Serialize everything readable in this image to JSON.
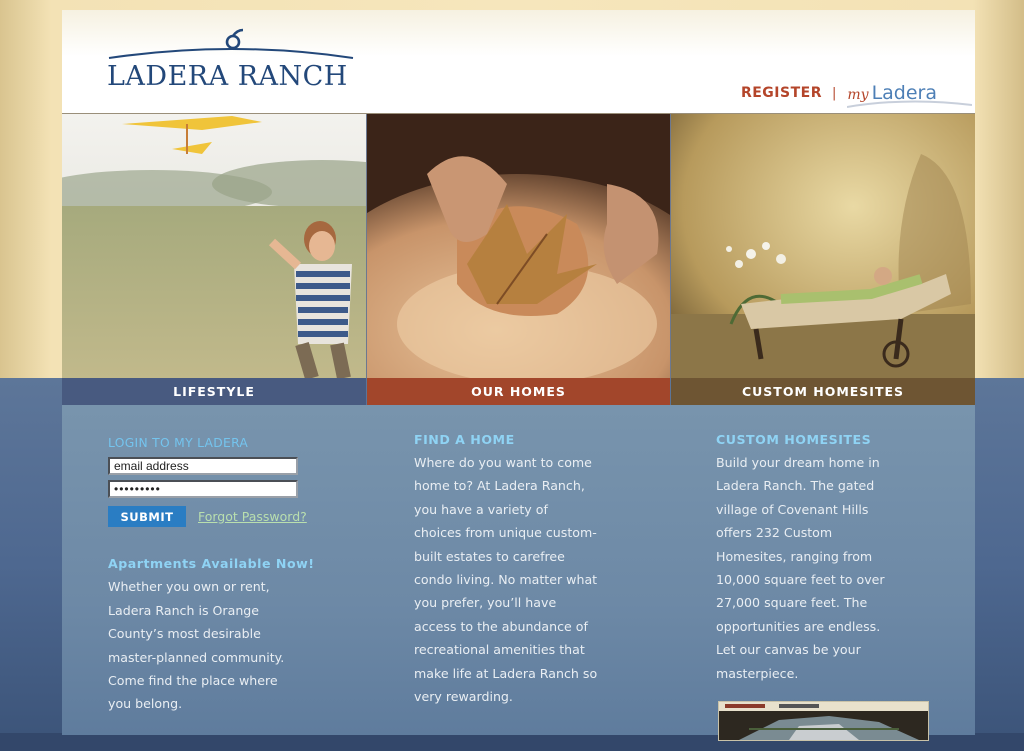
{
  "header": {
    "logo_text": "LADERA RANCH",
    "register_label": "REGISTER",
    "separator": "|",
    "my_label": "my",
    "ladera_label": "Ladera"
  },
  "hero_images": [
    {
      "alt": "Boy in striped shirt running in a field with a toy airplane"
    },
    {
      "alt": "Hands holding a dried autumn leaf over a plate"
    },
    {
      "alt": "Woman relaxing on a chaise lounge in a garden"
    }
  ],
  "nav": {
    "lifestyle": "LIFESTYLE",
    "our_homes": "OUR HOMES",
    "custom_homesites": "CUSTOM HOMESITES"
  },
  "login": {
    "title": "LOGIN TO MY LADERA",
    "email_value": "email address",
    "password_value": "•••••••••",
    "submit_label": "SUBMIT",
    "forgot_label": "Forgot Password?"
  },
  "apartments": {
    "heading": "Apartments Available Now!",
    "lines": [
      "Whether you own or rent,",
      "Ladera Ranch is Orange",
      "County’s most desirable",
      "master-planned community.",
      "Come find the place where",
      "you belong."
    ]
  },
  "find_home": {
    "heading": "FIND A HOME",
    "lines": [
      "Where do you want to come",
      "home to? At Ladera Ranch,",
      "you have a variety of",
      "choices from unique custom-",
      "built estates to carefree",
      "condo living. No matter what",
      "you prefer, you’ll have",
      "access to the abundance of",
      "recreational amenities that",
      "make life at Ladera Ranch so",
      "very rewarding."
    ]
  },
  "custom_homesites": {
    "heading": "CUSTOM HOMESITES",
    "lines": [
      "Build your dream home in",
      "Ladera Ranch. The gated",
      "village of Covenant Hills",
      "offers 232 Custom",
      "Homesites, ranging from",
      "10,000 square feet to over",
      "27,000 square feet. The",
      "opportunities are endless.",
      "Let our canvas be your",
      "masterpiece."
    ]
  },
  "colors": {
    "brand_blue": "#23487a",
    "register_red": "#b4452a",
    "heading_cyan": "#8fd3f4",
    "nav_lifestyle": "#485a80",
    "nav_homes": "#a2462b",
    "nav_custom": "#6e5533",
    "submit_blue": "#2a7dc3"
  }
}
